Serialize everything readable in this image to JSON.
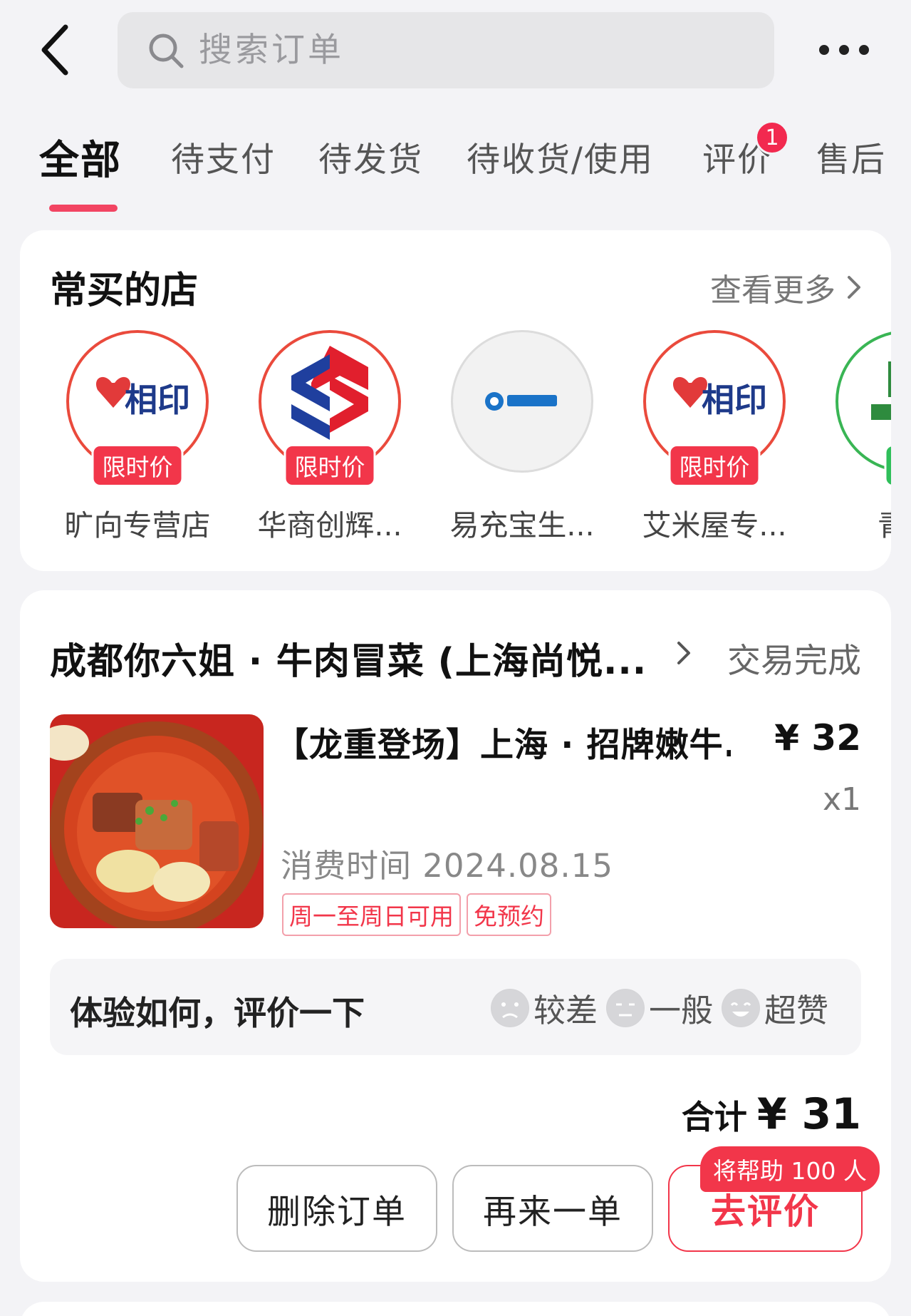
{
  "header": {
    "search_placeholder": "搜索订单"
  },
  "tabs": [
    {
      "label": "全部",
      "active": true
    },
    {
      "label": "待支付"
    },
    {
      "label": "待发货"
    },
    {
      "label": "待收货/使用"
    },
    {
      "label": "评价",
      "badge": "1"
    },
    {
      "label": "售后"
    }
  ],
  "frequent_stores": {
    "title": "常买的店",
    "see_more": "查看更多",
    "stores": [
      {
        "name": "旷向专营店",
        "badge": "限时价"
      },
      {
        "name": "华商创辉...",
        "badge": "限时价"
      },
      {
        "name": "易充宝生..."
      },
      {
        "name": "艾米屋专...",
        "badge": "限时价"
      },
      {
        "name": "青见",
        "badge": "有"
      }
    ]
  },
  "order": {
    "shop_name": "成都你六姐 · 牛肉冒菜 (上海尚悦...",
    "status": "交易完成",
    "product_title": "【龙重登场】上海 · 招牌嫩牛...",
    "price": "¥ 32",
    "quantity": "x1",
    "use_time": "消费时间 2024.08.15",
    "tags": [
      "周一至周日可用",
      "免预约"
    ],
    "review_prompt": "体验如何，评价一下",
    "review_options": [
      "较差",
      "一般",
      "超赞"
    ],
    "total_label": "合计",
    "total_amount": "¥ 31",
    "help_badge": "将帮助 100 人",
    "buttons": {
      "delete": "删除订单",
      "again": "再来一单",
      "review": "去评价"
    }
  },
  "colors": {
    "accent": "#f2364a",
    "tab_underline": "#f24462",
    "background": "#f3f3f6"
  }
}
